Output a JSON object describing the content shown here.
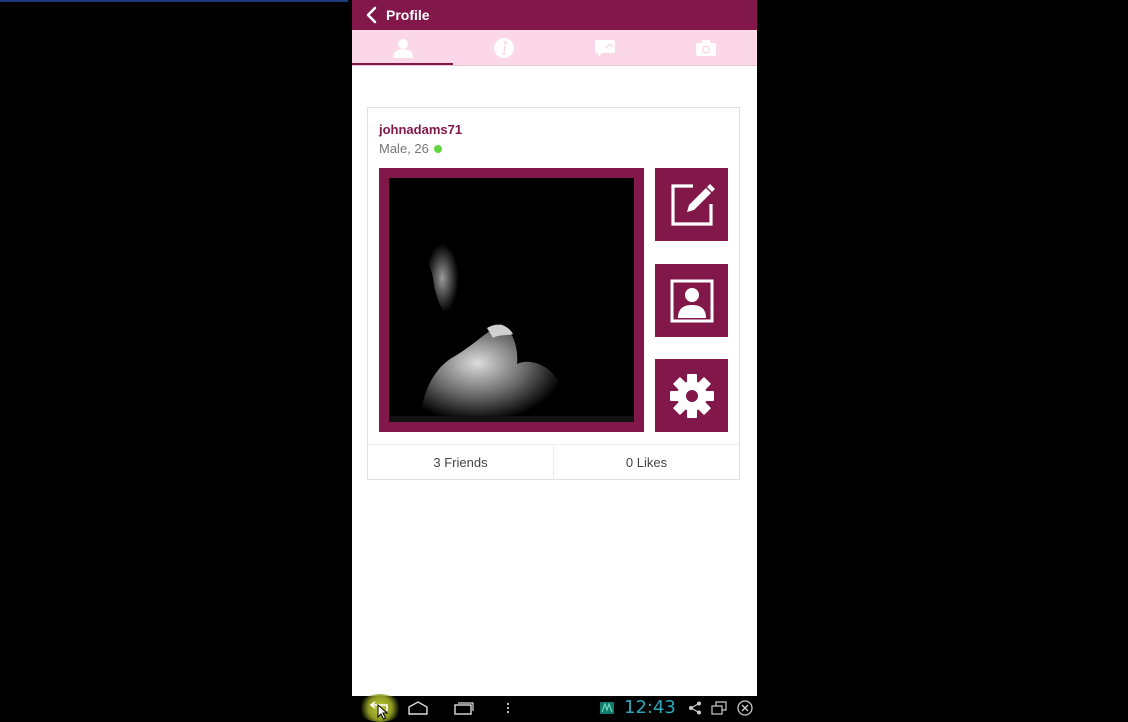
{
  "appbar": {
    "title": "Profile"
  },
  "tabs": [
    {
      "icon": "person-icon",
      "active": true
    },
    {
      "icon": "info-icon",
      "active": false
    },
    {
      "icon": "message-icon",
      "active": false
    },
    {
      "icon": "camera-icon",
      "active": false
    }
  ],
  "profile": {
    "username": "johnadams71",
    "gender_age": "Male, 26",
    "online": true
  },
  "actions": {
    "edit": "edit-icon",
    "avatar": "user-portrait-icon",
    "settings": "gear-icon"
  },
  "stats": {
    "friends": "3 Friends",
    "likes": "0 Likes"
  },
  "system": {
    "clock": "12:43"
  },
  "colors": {
    "brand": "#82174a",
    "tab_bg": "#fbd7e8",
    "online": "#62d640",
    "clock": "#2ba9b8"
  }
}
